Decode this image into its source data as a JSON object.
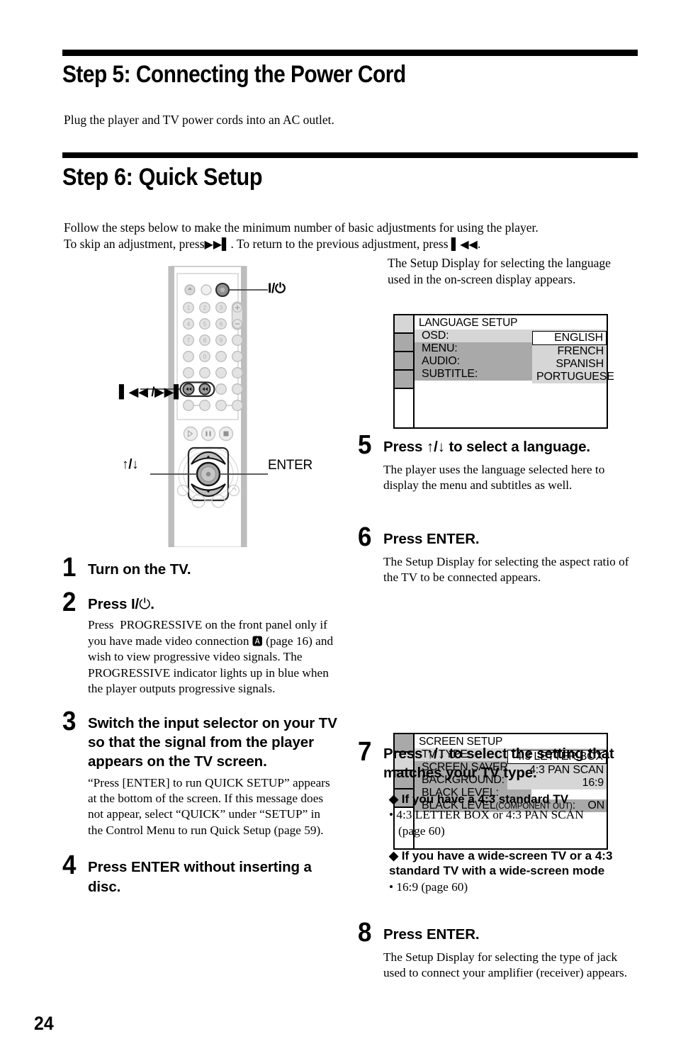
{
  "page": {
    "number": "24"
  },
  "section_step5": {
    "heading": "Step 5: Connecting the Power Cord",
    "paragraph": "Plug the player and TV power cords into an AC outlet."
  },
  "section_step6": {
    "heading": "Step 6: Quick Setup",
    "intro_line1": "Follow the steps below to make the minimum number of basic adjustments for using the player.",
    "intro_line2_a": "To skip an adjustment, press",
    "intro_line2_b": ". To return to the previous adjustment, press",
    "intro_line2_c": "."
  },
  "remote": {
    "callouts": {
      "power": "I/⏻",
      "prev_next": "⏮⏭",
      "up_down": "↑/↓",
      "enter": "ENTER"
    }
  },
  "steps_left": [
    {
      "num": "1",
      "title": "Turn on the TV.",
      "body": ""
    },
    {
      "num": "2",
      "title": "Press I/⏻.",
      "body": "Press PROGRESSIVE on the front panel only if you have made video connection Ⓒ (page 16) and wish to view progressive video signals. The PROGRESSIVE indicator lights up in blue when the player outputs progressive signals."
    },
    {
      "num": "3",
      "title": "Switch the input selector on your TV so that the signal from the player appears on the TV screen.",
      "body": "“Press [ENTER] to run QUICK SETUP” appears at the bottom of the screen. If this message does not appear, select “QUICK” under “SETUP” in the Control Menu to run Quick Setup (page 59)."
    },
    {
      "num": "4",
      "title": "Press ENTER without inserting a disc.",
      "body": ""
    }
  ],
  "steps_right": [
    {
      "num": "5",
      "title": "Press ↑/↓ to select a language.",
      "body": "The player uses the language selected here to display the menu and subtitles as well."
    },
    {
      "num": "6",
      "title": "Press ENTER.",
      "body": "The Setup Display for selecting the aspect ratio of the TV to be connected appears."
    },
    {
      "num": "7",
      "title": "Press ↑/↓ to select the setting that matches your TV type.",
      "body": ""
    },
    {
      "num": "8",
      "title": "Press ENTER.",
      "body": "The Setup Display for selecting the type of jack used to connect your amplifier (receiver) appears."
    }
  ],
  "step7_notes": {
    "diamond1": "◆ If you have a 4:3 standard TV",
    "bullet1_line1": "• 4:3 LETTER BOX or 4:3 PAN SCAN",
    "bullet1_line2": "(page 60)",
    "diamond2_line1": "◆ If you have a wide-screen TV or a 4:3",
    "diamond2_line2": "standard TV with a wide-screen mode",
    "bullet2": "• 16:9 (page 60)"
  },
  "intro_right": {
    "text": "The Setup Display for selecting the language used in the on-screen display appears."
  },
  "osd_language": {
    "title": "LANGUAGE SETUP",
    "rows": [
      {
        "label": "OSD:",
        "value": "ENGLISH",
        "state": "selected"
      },
      {
        "label": "MENU:",
        "value": "",
        "state": "grey"
      },
      {
        "label": "AUDIO:",
        "value": "",
        "state": "grey"
      },
      {
        "label": "SUBTITLE:",
        "value": "",
        "state": "grey"
      }
    ],
    "popup_options": [
      "ENGLISH",
      "FRENCH",
      "SPANISH",
      "PORTUGUESE"
    ],
    "popup_current": "ENGLISH",
    "active_tab_index": 0,
    "tab_count": 4
  },
  "osd_screen": {
    "title": "SCREEN SETUP",
    "rows": [
      {
        "label": "TV TYPE:",
        "value": "4:3 LETTER BOX",
        "state": "selected"
      },
      {
        "label": "SCREEN SAVER:",
        "value": "",
        "state": "grey"
      },
      {
        "label": "BACKGROUND:",
        "value": "",
        "state": "grey"
      },
      {
        "label": "BLACK LEVEL:",
        "value": "",
        "state": "grey"
      },
      {
        "label": "BLACK LEVEL",
        "sublabel": "(COMPONENT OUT)",
        "suffix": ":",
        "value": "ON",
        "state": "grey"
      }
    ],
    "popup_options": [
      "4:3 LETTER BOX",
      "4:3 PAN SCAN",
      "16:9"
    ],
    "popup_current": "4:3 LETTER BOX",
    "active_tab_index": 1,
    "tab_count": 4
  },
  "colors": {
    "osd_grey": "#a9a9a9",
    "osd_light": "#d6d6d6",
    "ink": "#000000",
    "remote_body": "#bdbdbd",
    "remote_button": "#c8c8c8"
  }
}
